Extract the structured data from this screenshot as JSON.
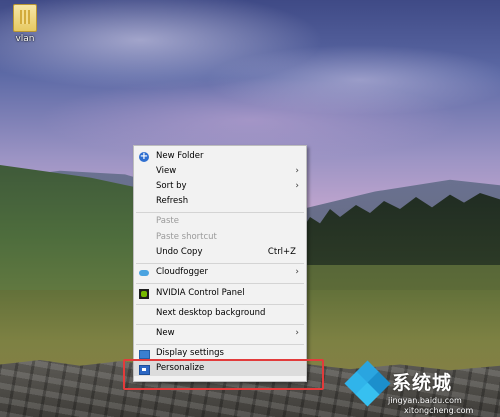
{
  "desktop": {
    "icons": [
      {
        "label": "vlan",
        "icon": "folder-icon"
      }
    ]
  },
  "context_menu": {
    "items": [
      {
        "label": "New Folder",
        "icon": "new-folder-icon",
        "enabled": true
      },
      {
        "label": "View",
        "submenu": true,
        "enabled": true
      },
      {
        "label": "Sort by",
        "submenu": true,
        "enabled": true
      },
      {
        "label": "Refresh",
        "enabled": true
      },
      {
        "label": "Paste",
        "enabled": false
      },
      {
        "label": "Paste shortcut",
        "enabled": false
      },
      {
        "label": "Undo Copy",
        "shortcut": "Ctrl+Z",
        "enabled": true
      },
      {
        "label": "Cloudfogger",
        "icon": "cloud-icon",
        "submenu": true,
        "enabled": true
      },
      {
        "label": "NVIDIA Control Panel",
        "icon": "nvidia-icon",
        "enabled": true
      },
      {
        "label": "Next desktop background",
        "enabled": true
      },
      {
        "label": "New",
        "submenu": true,
        "enabled": true
      },
      {
        "label": "Display settings",
        "icon": "display-icon",
        "enabled": true
      },
      {
        "label": "Personalize",
        "icon": "personalize-icon",
        "enabled": true,
        "highlighted": true
      }
    ],
    "submenu_arrow": "›"
  },
  "annotation": {
    "color": "#e23b3b",
    "target": "Personalize"
  },
  "watermark": {
    "text": "系统城",
    "url_line1": "jingyan.baidu.com",
    "url_line2": "xitongcheng.com"
  }
}
